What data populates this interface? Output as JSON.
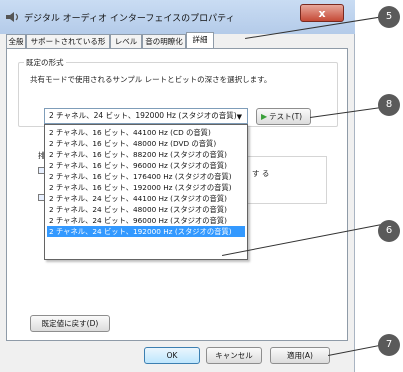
{
  "window": {
    "title": "デジタル オーディオ インターフェイスのプロパティ",
    "close_label": "x"
  },
  "tabs": [
    {
      "label": "全般"
    },
    {
      "label": "サポートされている形式"
    },
    {
      "label": "レベル"
    },
    {
      "label": "音の明瞭化"
    },
    {
      "label": "詳細"
    }
  ],
  "default_format": {
    "group_label": "既定の形式",
    "description": "共有モードで使用されるサンプル レートとビットの深さを選択します。",
    "selected": "2 チャネル、24 ビット、192000 Hz (スタジオの音質)",
    "test_label": "テスト(T)",
    "options": [
      "2 チャネル、16 ビット、44100 Hz (CD の音質)",
      "2 チャネル、16 ビット、48000 Hz (DVD の音質)",
      "2 チャネル、16 ビット、88200 Hz (スタジオの音質)",
      "2 チャネル、16 ビット、96000 Hz (スタジオの音質)",
      "2 チャネル、16 ビット、176400 Hz (スタジオの音質)",
      "2 チャネル、16 ビット、192000 Hz (スタジオの音質)",
      "2 チャネル、24 ビット、44100 Hz (スタジオの音質)",
      "2 チャネル、24 ビット、48000 Hz (スタジオの音質)",
      "2 チャネル、24 ビット、96000 Hz (スタジオの音質)",
      "2 チャネル、24 ビット、192000 Hz (スタジオの音質)"
    ],
    "selected_index": 9
  },
  "partial_texts": {
    "exclusive_fragment": "す る",
    "group_fragment": "排"
  },
  "buttons": {
    "reset": "既定値に戻す(D)",
    "ok": "OK",
    "cancel": "キャンセル",
    "apply": "適用(A)"
  },
  "callouts": [
    "5",
    "8",
    "6",
    "7"
  ]
}
